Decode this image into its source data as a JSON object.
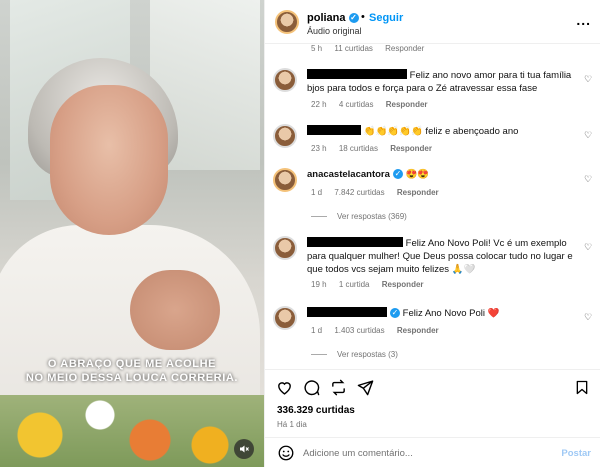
{
  "media": {
    "caption_line1": "O ABRAÇO QUE ME ACOLHE",
    "caption_line2": "NO MEIO DESSA LOUCA CORRERIA.",
    "mute_icon": "speaker-muted-icon"
  },
  "header": {
    "username": "poliana",
    "separator": "•",
    "follow_label": "Seguir",
    "audio_label": "Áudio original",
    "more_label": "..."
  },
  "partial_comment": {
    "time": "5 h",
    "likes": "11 curtidas",
    "reply": "Responder"
  },
  "comments": [
    {
      "text": "Feliz ano novo amor para ti tua família bjos para todos e força para o Zé atravessar essa fase",
      "time": "22 h",
      "likes": "4 curtidas",
      "reply": "Responder"
    },
    {
      "text": "👏👏👏👏👏 feliz e abençoado ano",
      "time": "23 h",
      "likes": "18 curtidas",
      "reply": "Responder"
    },
    {
      "username": "anacastelacantora",
      "text": "😍😍",
      "time": "1 d",
      "likes": "7.842 curtidas",
      "reply": "Responder",
      "view_replies": "Ver respostas (369)"
    },
    {
      "text": "Feliz Ano Novo Poli! Vc é um exemplo para qualquer mulher! Que Deus possa colocar tudo no lugar e que todos vcs sejam muito felizes 🙏🤍",
      "time": "19 h",
      "likes": "1 curtida",
      "reply": "Responder"
    },
    {
      "text": "Feliz Ano Novo Poli ❤️",
      "time": "1 d",
      "likes": "1.403 curtidas",
      "reply": "Responder",
      "view_replies": "Ver respostas (3)"
    }
  ],
  "footer": {
    "likes_count": "336.329 curtidas",
    "date": "Há 1 dia",
    "comment_placeholder": "Adicione um comentário...",
    "post_label": "Postar"
  },
  "colors": {
    "accent": "#0095f6",
    "verified": "#1d9bf0",
    "muted_text": "#737373"
  }
}
